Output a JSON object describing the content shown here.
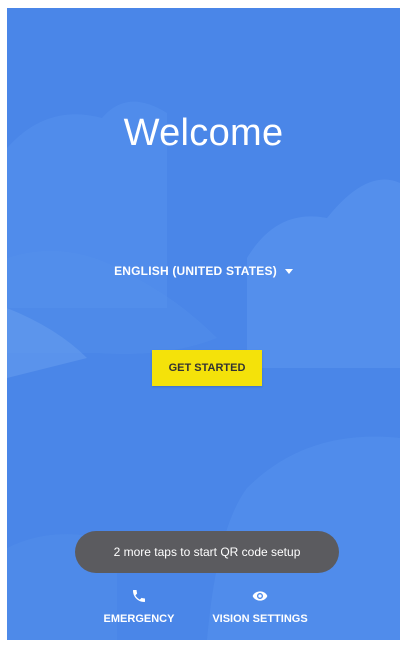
{
  "welcome": {
    "title": "Welcome"
  },
  "language": {
    "selected": "ENGLISH (UNITED STATES)",
    "icon": "dropdown-caret-icon"
  },
  "primary_action": {
    "label": "GET STARTED",
    "color": "#f4e20a"
  },
  "toast": {
    "message": "2 more taps to start QR code setup"
  },
  "bottom_actions": {
    "emergency": {
      "label": "EMERGENCY",
      "icon": "phone-icon"
    },
    "vision": {
      "label": "VISION SETTINGS",
      "icon": "eye-icon"
    }
  },
  "colors": {
    "background": "#4a86e8",
    "toast_background": "#5b5b5f",
    "text": "#ffffff"
  }
}
